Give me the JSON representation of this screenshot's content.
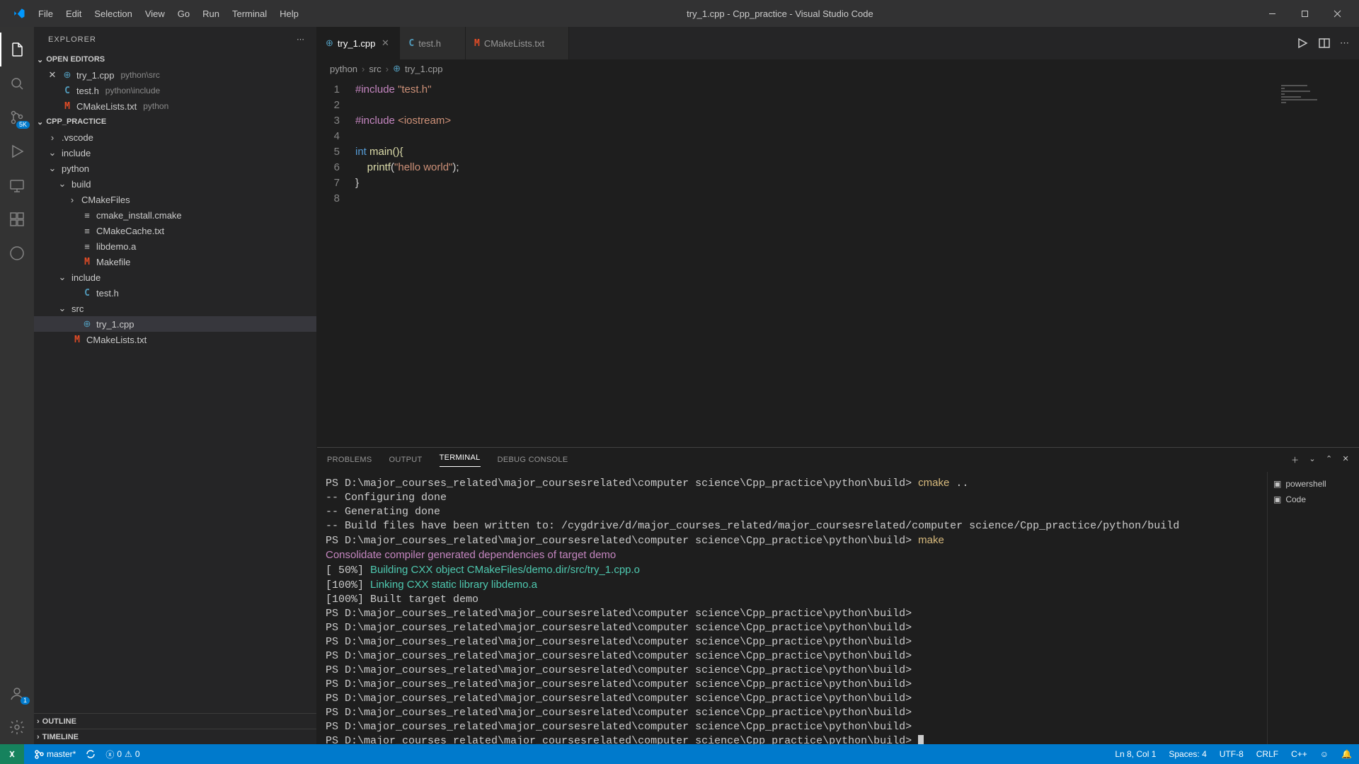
{
  "window": {
    "title": "try_1.cpp - Cpp_practice - Visual Studio Code"
  },
  "menu": {
    "items": [
      "File",
      "Edit",
      "Selection",
      "View",
      "Go",
      "Run",
      "Terminal",
      "Help"
    ]
  },
  "activity": {
    "scm_badge": "5K",
    "accounts_badge": "1"
  },
  "sidebar": {
    "title": "EXPLORER",
    "open_editors_label": "OPEN EDITORS",
    "open_editors": [
      {
        "name": "try_1.cpp",
        "hint": "python\\src",
        "icon": "cpp",
        "close": true
      },
      {
        "name": "test.h",
        "hint": "python\\include",
        "icon": "c"
      },
      {
        "name": "CMakeLists.txt",
        "hint": "python",
        "icon": "m"
      }
    ],
    "workspace_label": "CPP_PRACTICE",
    "tree": [
      {
        "indent": 0,
        "chev": "right",
        "name": ".vscode",
        "type": "folder"
      },
      {
        "indent": 0,
        "chev": "down",
        "name": "include",
        "type": "folder"
      },
      {
        "indent": 0,
        "chev": "down",
        "name": "python",
        "type": "folder"
      },
      {
        "indent": 1,
        "chev": "down",
        "name": "build",
        "type": "folder"
      },
      {
        "indent": 2,
        "chev": "right",
        "name": "CMakeFiles",
        "type": "folder"
      },
      {
        "indent": 2,
        "name": "cmake_install.cmake",
        "type": "file",
        "icon": "file"
      },
      {
        "indent": 2,
        "name": "CMakeCache.txt",
        "type": "file",
        "icon": "file"
      },
      {
        "indent": 2,
        "name": "libdemo.a",
        "type": "file",
        "icon": "file"
      },
      {
        "indent": 2,
        "name": "Makefile",
        "type": "file",
        "icon": "m"
      },
      {
        "indent": 1,
        "chev": "down",
        "name": "include",
        "type": "folder"
      },
      {
        "indent": 2,
        "name": "test.h",
        "type": "file",
        "icon": "c"
      },
      {
        "indent": 1,
        "chev": "down",
        "name": "src",
        "type": "folder"
      },
      {
        "indent": 2,
        "name": "try_1.cpp",
        "type": "file",
        "icon": "cpp",
        "active": true
      },
      {
        "indent": 1,
        "name": "CMakeLists.txt",
        "type": "file",
        "icon": "m"
      }
    ],
    "outline_label": "OUTLINE",
    "timeline_label": "TIMELINE"
  },
  "editor": {
    "tabs": [
      {
        "name": "try_1.cpp",
        "icon": "cpp",
        "active": true,
        "close": true
      },
      {
        "name": "test.h",
        "icon": "c"
      },
      {
        "name": "CMakeLists.txt",
        "icon": "m"
      }
    ],
    "breadcrumb": {
      "a": "python",
      "b": "src",
      "c": "try_1.cpp"
    },
    "code": {
      "l1a": "#include",
      "l1b": "\"test.h\"",
      "l3a": "#include",
      "l3b": "<iostream>",
      "l5a": "int",
      "l5b": " main(){",
      "l6a": "    printf",
      "l6b": "(",
      "l6c": "\"hello world\"",
      "l6d": ");",
      "l7": "}"
    }
  },
  "panel": {
    "tabs": {
      "problems": "PROBLEMS",
      "output": "OUTPUT",
      "terminal": "TERMINAL",
      "debug": "DEBUG CONSOLE"
    },
    "shells": [
      {
        "icon": "ps",
        "name": "powershell"
      },
      {
        "icon": "ps",
        "name": "Code"
      }
    ],
    "lines": {
      "p0": "PS D:\\major_courses_related\\major_coursesrelated\\computer science\\Cpp_practice\\python\\build> ",
      "cmake": "cmake",
      "cmake_arg": " ..",
      "l1": "-- Configuring done",
      "l2": "-- Generating done",
      "l3": "-- Build files have been written to: /cygdrive/d/major_courses_related/major_coursesrelated/computer science/Cpp_practice/python/build",
      "make": "make",
      "l4": "Consolidate compiler generated dependencies of target demo",
      "l5a": "[ 50%] ",
      "l5b": "Building CXX object CMakeFiles/demo.dir/src/try_1.cpp.o",
      "l6a": "[100%] ",
      "l6b": "Linking CXX static library libdemo.a",
      "l7": "[100%] Built target demo",
      "prompt": "PS D:\\major_courses_related\\major_coursesrelated\\computer science\\Cpp_practice\\python\\build>"
    }
  },
  "status": {
    "branch": "master*",
    "errors": "0",
    "warnings": "0",
    "ln": "Ln 8, Col 1",
    "spaces": "Spaces: 4",
    "encoding": "UTF-8",
    "eol": "CRLF",
    "lang": "C++"
  }
}
